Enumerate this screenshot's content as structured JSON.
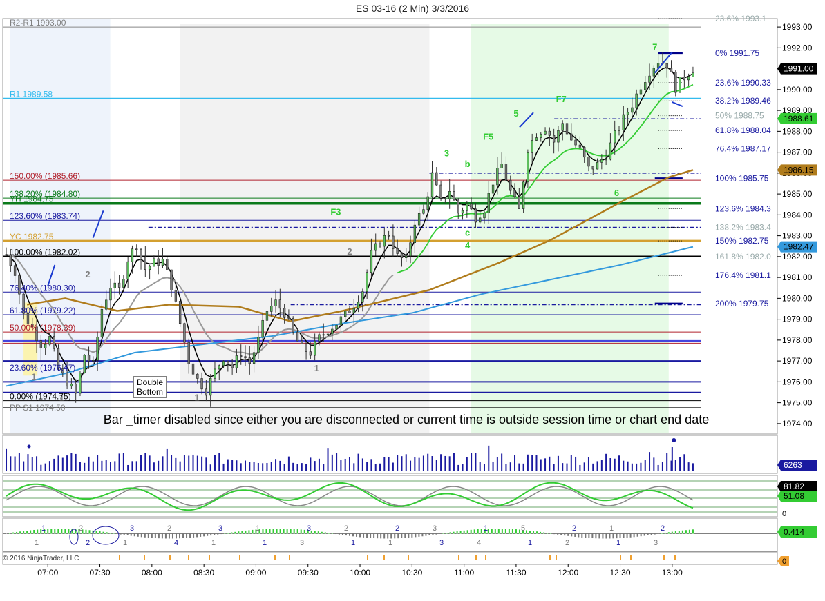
{
  "window": {
    "title": "ES 03-16 (2 Min)  3/3/2016"
  },
  "footer": {
    "copyright": "© 2016 NinjaTrader, LLC"
  },
  "notice": "Bar _timer disabled since either you are disconnected or current time is outside session time or chart end date",
  "colors": {
    "up_candle": "#5fbf5f",
    "down_candle": "#808080",
    "pivot_r1": "#33bbee",
    "yesterday_close": "#d4a030",
    "yesterday_high": "#0a7a1a",
    "fib_blue": "#1a1aa0",
    "fib_red": "#b0202c",
    "ema_black": "#000000",
    "ma_green": "#33cc33",
    "ma_brown": "#b07c1c",
    "ma_blue": "#3399dd",
    "session_green": "#e6fae6",
    "session_grey": "#f2f2f2"
  },
  "chart_data": {
    "type": "candlestick",
    "symbol": "ES 03-16",
    "interval": "2 Min",
    "date": "3/3/2016",
    "ylim": [
      1973.5,
      1993.4
    ],
    "y_ticks": [
      "1974.00",
      "1975.00",
      "1976.00",
      "1977.00",
      "1978.00",
      "1979.00",
      "1980.00",
      "1981.00",
      "1982.00",
      "1983.00",
      "1984.00",
      "1985.00",
      "1986.00",
      "1987.00",
      "1988.00",
      "1989.00",
      "1990.00",
      "1991.00",
      "1992.00",
      "1993.00"
    ],
    "x_ticks": [
      "07:00",
      "07:30",
      "08:00",
      "08:30",
      "09:00",
      "09:30",
      "10:00",
      "10:30",
      "11:00",
      "11:30",
      "12:00",
      "12:30",
      "13:00"
    ],
    "x_tick_minutes": [
      420,
      450,
      480,
      510,
      540,
      570,
      600,
      630,
      660,
      690,
      720,
      750,
      780
    ],
    "x_range_minutes": [
      394,
      798
    ],
    "price_badges": [
      {
        "label": "1991.00",
        "value": 1991.0,
        "color": "#000000"
      },
      {
        "label": "1988.61",
        "value": 1988.61,
        "color": "#33cc33"
      },
      {
        "label": "1986.15",
        "value": 1986.15,
        "color": "#b07c1c"
      },
      {
        "label": "1982.47",
        "value": 1982.47,
        "color": "#3399dd"
      }
    ],
    "level_labels_left": [
      {
        "text": "R2-R1 1993.00",
        "value": 1993.0,
        "color": "#808080"
      },
      {
        "text": "R1 1989.58",
        "value": 1989.58,
        "color": "#33bbee"
      },
      {
        "text": "150.00% (1985.66)",
        "value": 1985.66,
        "color": "#b0202c"
      },
      {
        "text": "138.20% (1984.80)",
        "value": 1984.8,
        "color": "#0a7a1a"
      },
      {
        "text": "YH 1984.75",
        "value": 1984.55,
        "color": "#0a7a1a"
      },
      {
        "text": "123.60% (1983.74)",
        "value": 1983.74,
        "color": "#1a1aa0"
      },
      {
        "text": "YC 1982.75",
        "value": 1982.75,
        "color": "#d4a030"
      },
      {
        "text": "100.00% (1982.02)",
        "value": 1982.02,
        "color": "#000000"
      },
      {
        "text": "76.40% (1980.30)",
        "value": 1980.3,
        "color": "#1a1aa0"
      },
      {
        "text": "61.80% (1979.22)",
        "value": 1979.22,
        "color": "#1a1aa0"
      },
      {
        "text": "50.00% (1978.39)",
        "value": 1978.39,
        "color": "#b0202c"
      },
      {
        "text": "23.60% (1976.47)",
        "value": 1976.47,
        "color": "#1a1aa0"
      },
      {
        "text": "0.00% (1974.75)",
        "value": 1975.1,
        "color": "#000000"
      },
      {
        "text": "PP S1 1974.50",
        "value": 1974.55,
        "color": "#808080"
      }
    ],
    "fib_right": [
      {
        "text": "23.6% 1993.1",
        "value": 1993.4
      },
      {
        "text": "0%  1991.75",
        "value": 1991.75
      },
      {
        "text": "23.6%  1990.33",
        "value": 1990.33
      },
      {
        "text": "38.2%  1989.46",
        "value": 1989.46
      },
      {
        "text": "50%  1988.75",
        "value": 1988.75
      },
      {
        "text": "61.8%  1988.04",
        "value": 1988.04
      },
      {
        "text": "76.4%  1987.17",
        "value": 1987.17
      },
      {
        "text": "100%  1985.75",
        "value": 1985.75
      },
      {
        "text": "123.6%  1984.3",
        "value": 1984.3
      },
      {
        "text": "138.2%  1983.4",
        "value": 1983.4
      },
      {
        "text": "150%  1982.75",
        "value": 1982.75
      },
      {
        "text": "161.8%  1982.0",
        "value": 1982.0
      },
      {
        "text": "176.4%  1981.1",
        "value": 1981.1
      },
      {
        "text": "200%  1979.75",
        "value": 1979.75
      }
    ],
    "annotations": [
      {
        "text": "F3",
        "t": 586,
        "value": 1984.0,
        "color": "#33cc33"
      },
      {
        "text": "F5",
        "t": 674,
        "value": 1987.6,
        "color": "#33cc33"
      },
      {
        "text": "F7",
        "t": 716,
        "value": 1989.4,
        "color": "#33cc33"
      },
      {
        "text": "3",
        "t": 650,
        "value": 1986.8,
        "color": "#33cc33"
      },
      {
        "text": "5",
        "t": 690,
        "value": 1988.7,
        "color": "#33cc33"
      },
      {
        "text": "7",
        "t": 770,
        "value": 1991.9,
        "color": "#33cc33"
      },
      {
        "text": "b",
        "t": 662,
        "value": 1986.3,
        "color": "#33cc33"
      },
      {
        "text": "c",
        "t": 662,
        "value": 1983.0,
        "color": "#33cc33"
      },
      {
        "text": "4",
        "t": 662,
        "value": 1982.4,
        "color": "#33cc33"
      },
      {
        "text": "6",
        "t": 748,
        "value": 1984.9,
        "color": "#33cc33"
      },
      {
        "text": "2",
        "t": 594,
        "value": 1982.1,
        "color": "#808080"
      },
      {
        "text": "2",
        "t": 443,
        "value": 1981.0,
        "color": "#808080"
      },
      {
        "text": "1",
        "t": 412,
        "value": 1976.1,
        "color": "#808080"
      },
      {
        "text": "1",
        "t": 428,
        "value": 1975.1,
        "color": "#808080"
      },
      {
        "text": "1",
        "t": 506,
        "value": 1975.1,
        "color": "#808080"
      },
      {
        "text": "1",
        "t": 575,
        "value": 1976.5,
        "color": "#808080"
      }
    ],
    "pattern_label": {
      "line1": "Double",
      "line2": "Bottom"
    },
    "volume_badge": "6263",
    "stoch_badges": [
      {
        "label": "81.82",
        "color": "#000000"
      },
      {
        "label": "51.08",
        "color": "#33cc33"
      }
    ],
    "stoch_zero_label": "0",
    "macd_badge": "0.414",
    "bottom_badge": "0",
    "wave_labels_blue": [
      "1",
      "2",
      "3",
      "4",
      "3",
      "1",
      "3",
      "1",
      "2",
      "3",
      "1",
      "1",
      "2",
      "1",
      "2"
    ],
    "wave_labels_grey": [
      "1",
      "2",
      "1",
      "2",
      "1",
      "1",
      "3",
      "2",
      "1",
      "3",
      "4",
      "5",
      "2",
      "1",
      "3"
    ]
  }
}
